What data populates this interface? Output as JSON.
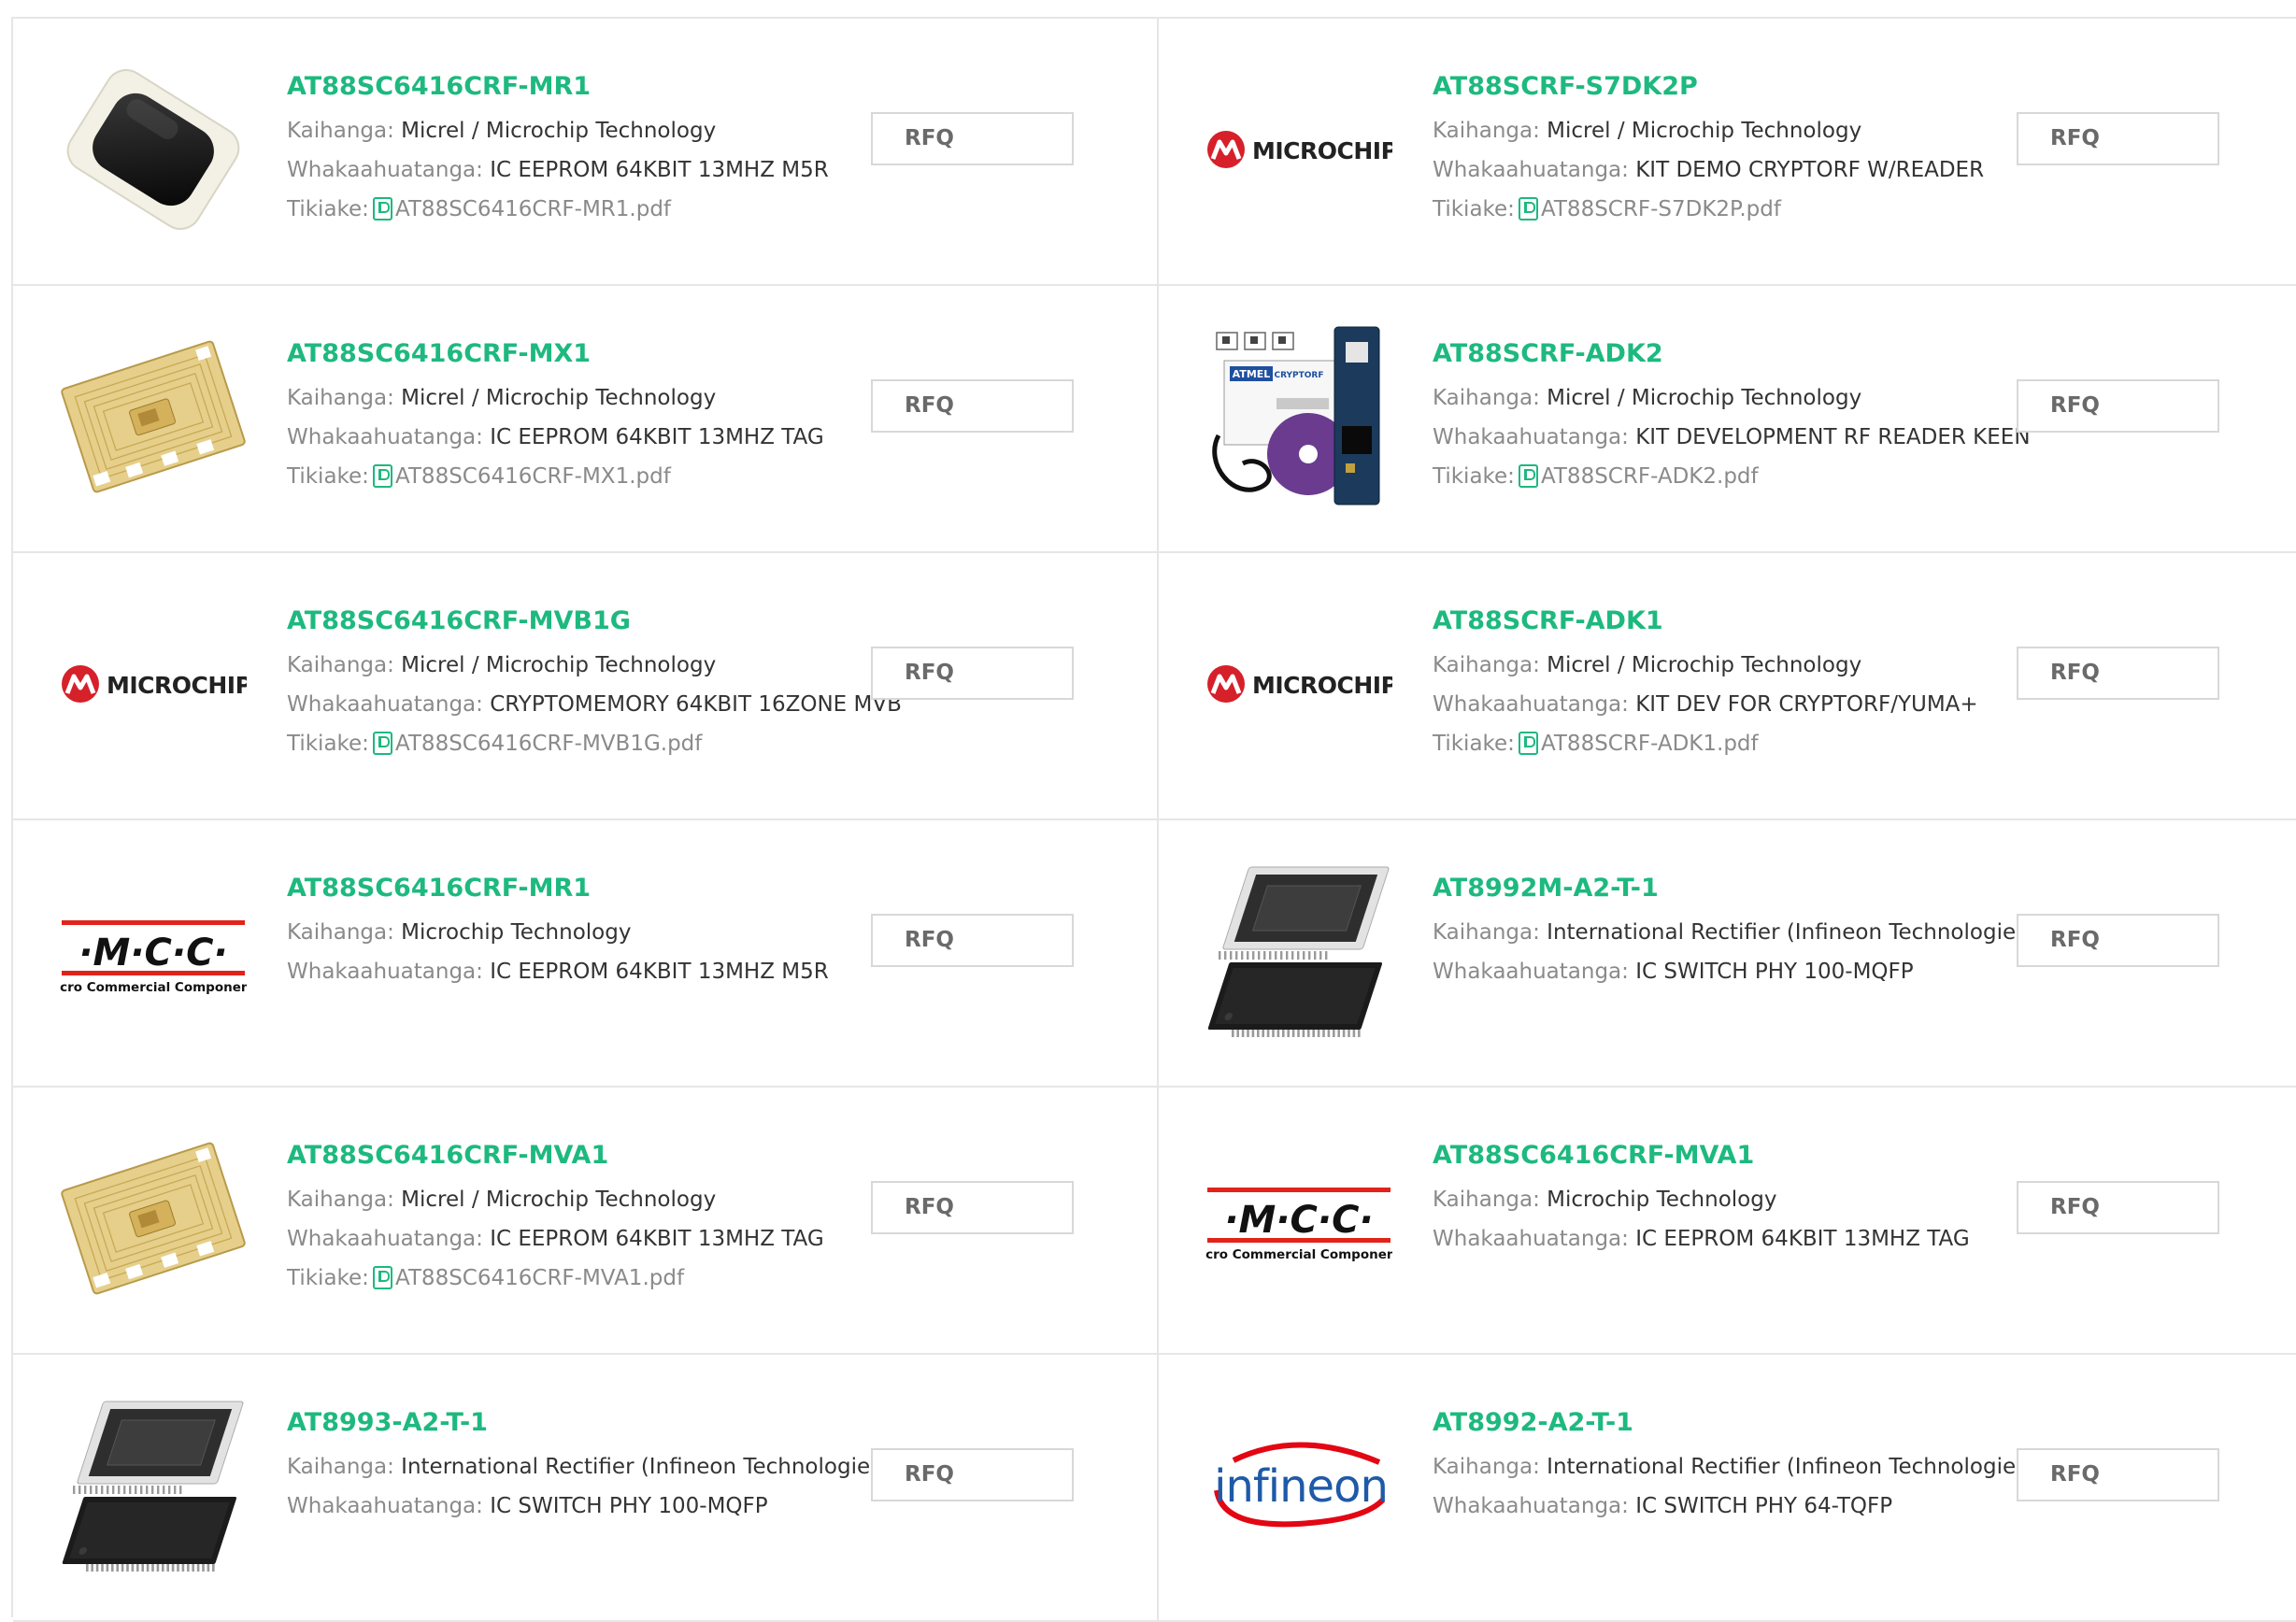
{
  "labels": {
    "manufacturer": "Kaihanga:",
    "description": "Whakaahuatanga:",
    "datasheet": "Tikiake:",
    "rfq": "RFQ"
  },
  "products": [
    {
      "part": "AT88SC6416CRF-MR1",
      "manufacturer": "Micrel / Microchip Technology",
      "description": "IC EEPROM 64KBIT 13MHZ M5R",
      "datasheet": "AT88SC6416CRF-MR1.pdf",
      "image": "chip-module-black-icon"
    },
    {
      "part": "AT88SCRF-S7DK2P",
      "manufacturer": "Micrel / Microchip Technology",
      "description": "KIT DEMO CRYPTORF W/READER",
      "datasheet": "AT88SCRF-S7DK2P.pdf",
      "image": "microchip-logo"
    },
    {
      "part": "AT88SC6416CRF-MX1",
      "manufacturer": "Micrel / Microchip Technology",
      "description": "IC EEPROM 64KBIT 13MHZ TAG",
      "datasheet": "AT88SC6416CRF-MX1.pdf",
      "image": "rfid-tag-icon"
    },
    {
      "part": "AT88SCRF-ADK2",
      "manufacturer": "Micrel / Microchip Technology",
      "description": "KIT DEVELOPMENT RF READER KEEN",
      "datasheet": "AT88SCRF-ADK2.pdf",
      "image": "dev-kit-icon"
    },
    {
      "part": "AT88SC6416CRF-MVB1G",
      "manufacturer": "Micrel / Microchip Technology",
      "description": "CRYPTOMEMORY 64KBIT 16ZONE MVB",
      "datasheet": "AT88SC6416CRF-MVB1G.pdf",
      "image": "microchip-logo"
    },
    {
      "part": "AT88SCRF-ADK1",
      "manufacturer": "Micrel / Microchip Technology",
      "description": "KIT DEV FOR CRYPTORF/YUMA+",
      "datasheet": "AT88SCRF-ADK1.pdf",
      "image": "microchip-logo"
    },
    {
      "part": "AT88SC6416CRF-MR1",
      "manufacturer": "Microchip Technology",
      "description": "IC EEPROM 64KBIT 13MHZ M5R",
      "datasheet": null,
      "image": "mcc-logo"
    },
    {
      "part": "AT8992M-A2-T-1",
      "manufacturer": "International Rectifier (Infineon Technologies)",
      "description": "IC SWITCH PHY 100-MQFP",
      "datasheet": null,
      "image": "qfp-chip-icon"
    },
    {
      "part": "AT88SC6416CRF-MVA1",
      "manufacturer": "Micrel / Microchip Technology",
      "description": "IC EEPROM 64KBIT 13MHZ TAG",
      "datasheet": "AT88SC6416CRF-MVA1.pdf",
      "image": "rfid-tag-icon"
    },
    {
      "part": "AT88SC6416CRF-MVA1",
      "manufacturer": "Microchip Technology",
      "description": "IC EEPROM 64KBIT 13MHZ TAG",
      "datasheet": null,
      "image": "mcc-logo"
    },
    {
      "part": "AT8993-A2-T-1",
      "manufacturer": "International Rectifier (Infineon Technologies)",
      "description": "IC SWITCH PHY 100-MQFP",
      "datasheet": null,
      "image": "qfp-chip-icon"
    },
    {
      "part": "AT8992-A2-T-1",
      "manufacturer": "International Rectifier (Infineon Technologies)",
      "description": "IC SWITCH PHY 64-TQFP",
      "datasheet": null,
      "image": "infineon-logo"
    }
  ],
  "logos": {
    "microchip": "MICROCHIP",
    "mcc_big": "·M·C·C·",
    "mcc_small": "Micro Commercial Components",
    "infineon": "infineon",
    "kit_brand": "ATMEL",
    "kit_label": "CRYPTORF"
  },
  "colors": {
    "accent": "#1db97f",
    "microchip_red": "#d6202a",
    "mcc_red": "#e2231a",
    "infineon_blue": "#1e5aa8",
    "infineon_red": "#e30613"
  }
}
